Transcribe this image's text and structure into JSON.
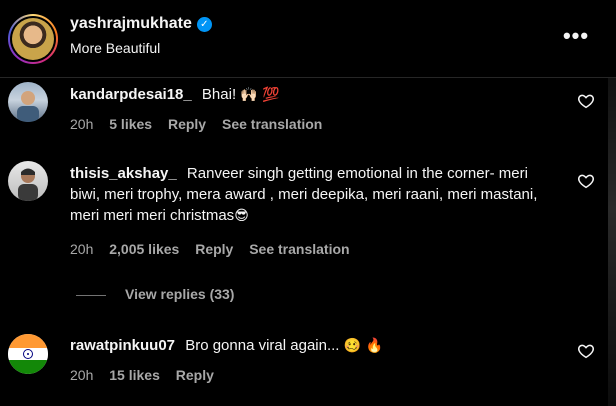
{
  "header": {
    "username": "yashrajmukhate",
    "subtitle": "More Beautiful",
    "more_label": "•••"
  },
  "comments": [
    {
      "username": "kandarpdesai18_",
      "text": "Bhai!",
      "emoji": "🙌🏻 💯",
      "time": "20h",
      "likes": "5 likes",
      "reply": "Reply",
      "translate": "See translation"
    },
    {
      "username": "thisis_akshay_",
      "text": "Ranveer singh getting emotional in the corner- meri biwi, meri trophy, mera award , meri deepika, meri raani, meri mastani, meri meri meri christmas",
      "emoji": "😎",
      "time": "20h",
      "likes": "2,005 likes",
      "reply": "Reply",
      "translate": "See translation",
      "view_replies": "View replies (33)"
    },
    {
      "username": "rawatpinkuu07",
      "text": "Bro gonna viral again...",
      "emoji": "🥴 🔥",
      "time": "20h",
      "likes": "15 likes",
      "reply": "Reply"
    }
  ],
  "icons": {
    "verified": "verified-badge-icon",
    "more": "more-options-icon",
    "like": "heart-outline-icon"
  },
  "colors": {
    "background": "#000000",
    "text": "#f5f5f5",
    "secondary": "#a8a8a8",
    "verified": "#0095f6"
  }
}
